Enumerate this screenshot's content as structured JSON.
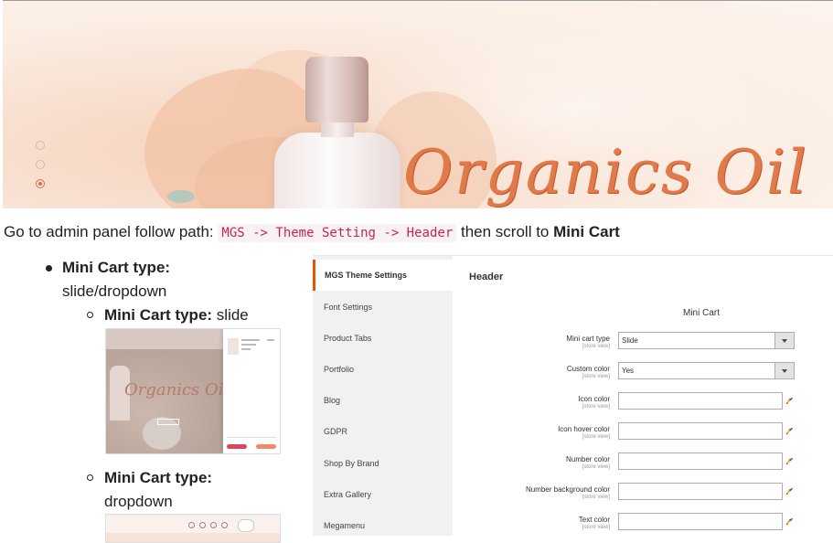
{
  "banner": {
    "brand_text": "Organics Oil",
    "colors": {
      "brand": "#e07a4a",
      "dot_active": "#e86a4a"
    },
    "slider_dots": 3,
    "active_dot": 3
  },
  "intro": {
    "prefix": "Go to admin panel follow path:",
    "path": "MGS -> Theme Setting -> Header",
    "middle": "then scroll to",
    "target": "Mini Cart"
  },
  "list": {
    "item1_label": "Mini Cart type:",
    "item1_value": "slide/dropdown",
    "sub1_label": "Mini Cart type:",
    "sub1_value": "slide",
    "sub2_label": "Mini Cart type:",
    "sub2_value": "dropdown"
  },
  "thumb_slide": {
    "brand": "Organics Oil"
  },
  "admin": {
    "sidebar": [
      "MGS Theme Settings",
      "Font Settings",
      "Product Tabs",
      "Portfolio",
      "Blog",
      "GDPR",
      "Shop By Brand",
      "Extra Gallery",
      "Megamenu"
    ],
    "section_title": "Header",
    "group_title": "Mini Cart",
    "scope_label": "[store view]",
    "fields": [
      {
        "label": "Mini cart type",
        "type": "select",
        "value": "Slide"
      },
      {
        "label": "Custom color",
        "type": "select",
        "value": "Yes"
      },
      {
        "label": "Icon color",
        "type": "color",
        "value": ""
      },
      {
        "label": "Icon hover color",
        "type": "color",
        "value": ""
      },
      {
        "label": "Number color",
        "type": "color",
        "value": ""
      },
      {
        "label": "Number background color",
        "type": "color",
        "value": ""
      },
      {
        "label": "Text color",
        "type": "color",
        "value": ""
      }
    ],
    "colors": {
      "active_accent": "#eb5202"
    }
  }
}
